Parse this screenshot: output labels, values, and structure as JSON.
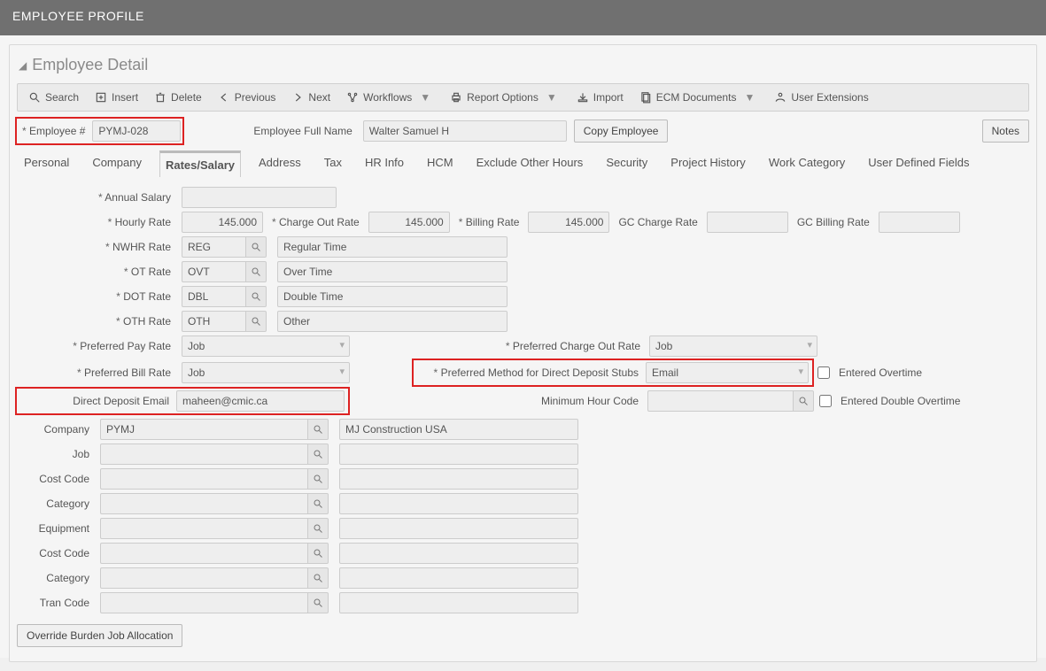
{
  "title": "EMPLOYEE PROFILE",
  "panel": {
    "title": "Employee Detail"
  },
  "toolbar": {
    "search": "Search",
    "insert": "Insert",
    "delete": "Delete",
    "previous": "Previous",
    "next": "Next",
    "workflows": "Workflows",
    "report_options": "Report Options",
    "import": "Import",
    "ecm_documents": "ECM Documents",
    "user_extensions": "User Extensions"
  },
  "header": {
    "employee_no_label": "Employee #",
    "employee_no": "PYMJ-028",
    "full_name_label": "Employee Full Name",
    "full_name": "Walter Samuel H",
    "copy_employee": "Copy Employee",
    "notes": "Notes"
  },
  "tabs": [
    "Personal",
    "Company",
    "Rates/Salary",
    "Address",
    "Tax",
    "HR Info",
    "HCM",
    "Exclude Other Hours",
    "Security",
    "Project History",
    "Work Category",
    "User Defined Fields"
  ],
  "active_tab": "Rates/Salary",
  "rates": {
    "annual_salary_label": "Annual Salary",
    "annual_salary": "",
    "hourly_rate_label": "Hourly Rate",
    "hourly_rate": "145.000",
    "charge_out_rate_label": "Charge Out Rate",
    "charge_out_rate": "145.000",
    "billing_rate_label": "Billing Rate",
    "billing_rate": "145.000",
    "gc_charge_rate_label": "GC Charge Rate",
    "gc_charge_rate": "",
    "gc_billing_rate_label": "GC Billing Rate",
    "gc_billing_rate": "",
    "nwhr_rate_label": "NWHR Rate",
    "nwhr_rate_code": "REG",
    "nwhr_rate_desc": "Regular Time",
    "ot_rate_label": "OT Rate",
    "ot_rate_code": "OVT",
    "ot_rate_desc": "Over Time",
    "dot_rate_label": "DOT Rate",
    "dot_rate_code": "DBL",
    "dot_rate_desc": "Double Time",
    "oth_rate_label": "OTH Rate",
    "oth_rate_code": "OTH",
    "oth_rate_desc": "Other",
    "pref_pay_rate_label": "Preferred Pay Rate",
    "pref_pay_rate": "Job",
    "pref_charge_out_label": "Preferred Charge Out Rate",
    "pref_charge_out": "Job",
    "pref_bill_rate_label": "Preferred Bill Rate",
    "pref_bill_rate": "Job",
    "pref_dd_method_label": "Preferred Method for Direct Deposit Stubs",
    "pref_dd_method": "Email",
    "entered_ot_label": "Entered Overtime",
    "dd_email_label": "Direct Deposit Email",
    "dd_email": "maheen@cmic.ca",
    "min_hour_code_label": "Minimum Hour Code",
    "min_hour_code": "",
    "entered_dot_label": "Entered Double Overtime"
  },
  "alloc": {
    "company_label": "Company",
    "company_code": "PYMJ",
    "company_desc": "MJ Construction USA",
    "job_label": "Job",
    "cost_code_label": "Cost Code",
    "category_label": "Category",
    "equipment_label": "Equipment",
    "cost_code2_label": "Cost Code",
    "category2_label": "Category",
    "tran_code_label": "Tran Code"
  },
  "buttons": {
    "override": "Override Burden Job Allocation"
  }
}
